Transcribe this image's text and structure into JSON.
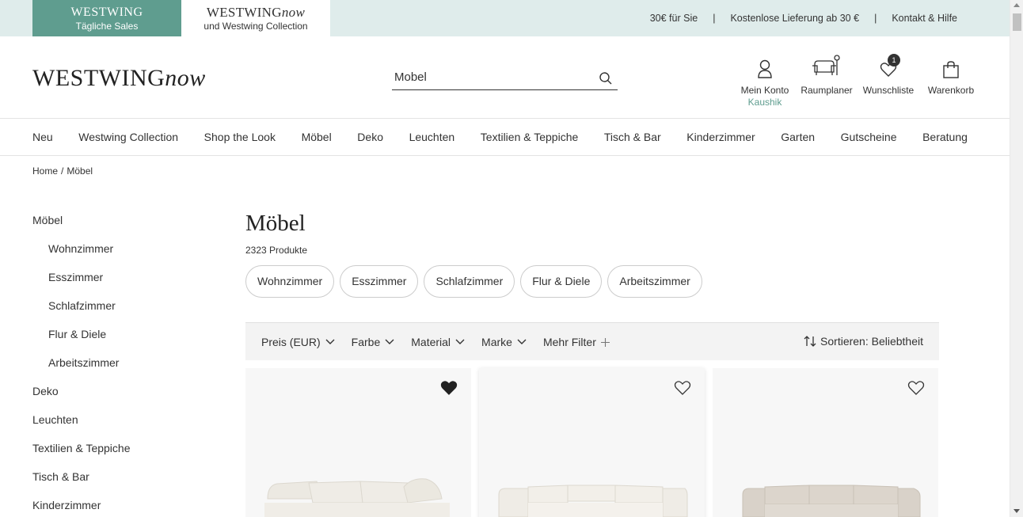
{
  "topbar": {
    "sales_brand": "WESTWING",
    "sales_sub": "Tägliche Sales",
    "now_brand_main": "WESTWING",
    "now_brand_italic": "now",
    "now_sub": "und Westwing Collection",
    "links": [
      "30€ für Sie",
      "Kostenlose Lieferung ab 30 €",
      "Kontakt & Hilfe"
    ]
  },
  "header": {
    "logo_main": "WESTWING",
    "logo_italic": "now",
    "search_value": "Mobel",
    "account_label": "Mein Konto",
    "account_user": "Kaushik",
    "room_label": "Raumplaner",
    "wishlist_label": "Wunschliste",
    "wishlist_count": "1",
    "cart_label": "Warenkorb"
  },
  "nav": [
    "Neu",
    "Westwing Collection",
    "Shop the Look",
    "Möbel",
    "Deko",
    "Leuchten",
    "Textilien & Teppiche",
    "Tisch & Bar",
    "Kinderzimmer",
    "Garten",
    "Gutscheine",
    "Beratung"
  ],
  "breadcrumb": {
    "home": "Home",
    "sep": "/",
    "current": "Möbel"
  },
  "sidebar": {
    "top": "Möbel",
    "subs": [
      "Wohnzimmer",
      "Esszimmer",
      "Schlafzimmer",
      "Flur & Diele",
      "Arbeitszimmer"
    ],
    "others": [
      "Deko",
      "Leuchten",
      "Textilien & Teppiche",
      "Tisch & Bar",
      "Kinderzimmer"
    ]
  },
  "main": {
    "title": "Möbel",
    "count": "2323 Produkte",
    "chips": [
      "Wohnzimmer",
      "Esszimmer",
      "Schlafzimmer",
      "Flur & Diele",
      "Arbeitszimmer"
    ],
    "filters": [
      "Preis (EUR)",
      "Farbe",
      "Material",
      "Marke"
    ],
    "more_filters": "Mehr Filter",
    "sort": "Sortieren: Beliebtheit"
  },
  "colors": {
    "accent": "#5f9d8f",
    "topbar_bg": "#dfeceb"
  }
}
